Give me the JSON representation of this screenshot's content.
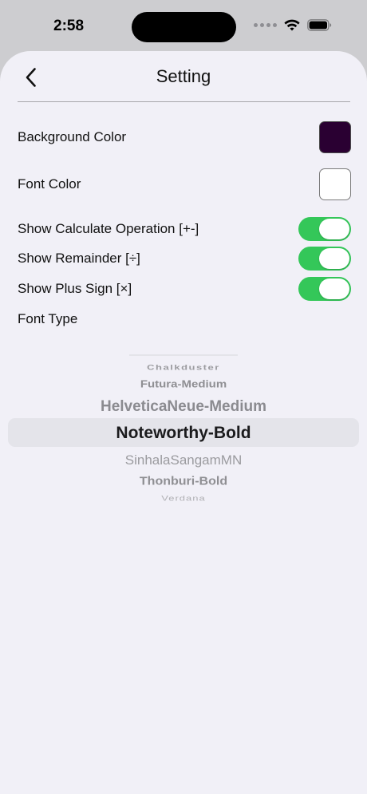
{
  "status_bar": {
    "time": "2:58"
  },
  "nav": {
    "title": "Setting"
  },
  "settings": {
    "background_color_label": "Background Color",
    "background_color_value": "#2a0032",
    "font_color_label": "Font Color",
    "font_color_value": "#ffffff",
    "show_calc_label": "Show Calculate Operation [+-]",
    "show_calc_on": true,
    "show_remainder_label": "Show Remainder [÷]",
    "show_remainder_on": true,
    "show_plus_label": "Show Plus Sign [×]",
    "show_plus_on": true,
    "font_type_label": "Font Type"
  },
  "font_picker": {
    "items": [
      "Chalkduster",
      "Futura-Medium",
      "HelveticaNeue-Medium",
      "Noteworthy-Bold",
      "SinhalaSangamMN",
      "Thonburi-Bold",
      "Verdana"
    ],
    "selected": "Noteworthy-Bold"
  },
  "colors": {
    "toggle_on": "#34c759",
    "sheet_background": "#f1f0f7"
  }
}
